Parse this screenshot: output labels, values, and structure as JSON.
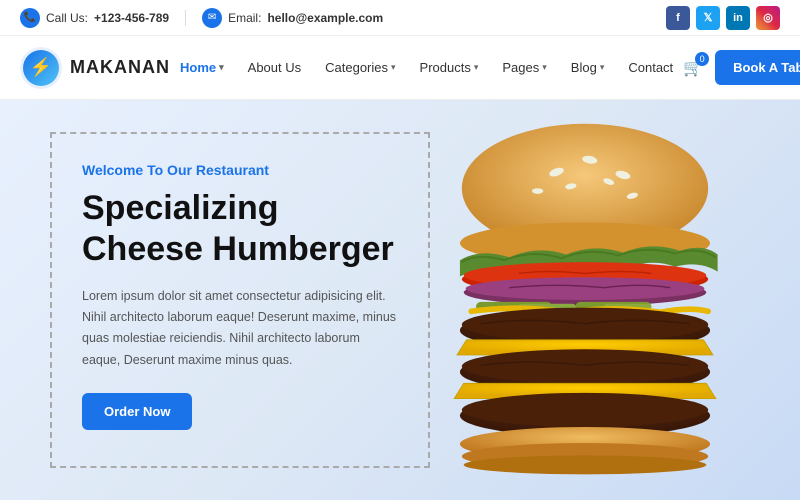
{
  "topbar": {
    "call_label": "Call Us:",
    "call_number": "+123-456-789",
    "email_label": "Email:",
    "email_value": "hello@example.com"
  },
  "social": {
    "facebook": "f",
    "twitter": "t",
    "linkedin": "in",
    "instagram": "ig"
  },
  "nav": {
    "logo_text": "MAKANAN",
    "items": [
      {
        "label": "Home",
        "has_dropdown": true,
        "active": true
      },
      {
        "label": "About Us",
        "has_dropdown": false
      },
      {
        "label": "Categories",
        "has_dropdown": true
      },
      {
        "label": "Products",
        "has_dropdown": true
      },
      {
        "label": "Pages",
        "has_dropdown": true
      },
      {
        "label": "Blog",
        "has_dropdown": true
      },
      {
        "label": "Contact",
        "has_dropdown": false
      }
    ],
    "cart_count": "0",
    "book_button": "Book A Table"
  },
  "hero": {
    "subtitle": "Welcome To Our Restaurant",
    "title": "Specializing Cheese Humberger",
    "description": "Lorem ipsum dolor sit amet consectetur adipisicing elit. Nihil architecto laborum eaque! Deserunt maxime, minus quas molestiae reiciendis. Nihil architecto laborum eaque, Deserunt maxime minus quas.",
    "cta_button": "Order Now"
  }
}
